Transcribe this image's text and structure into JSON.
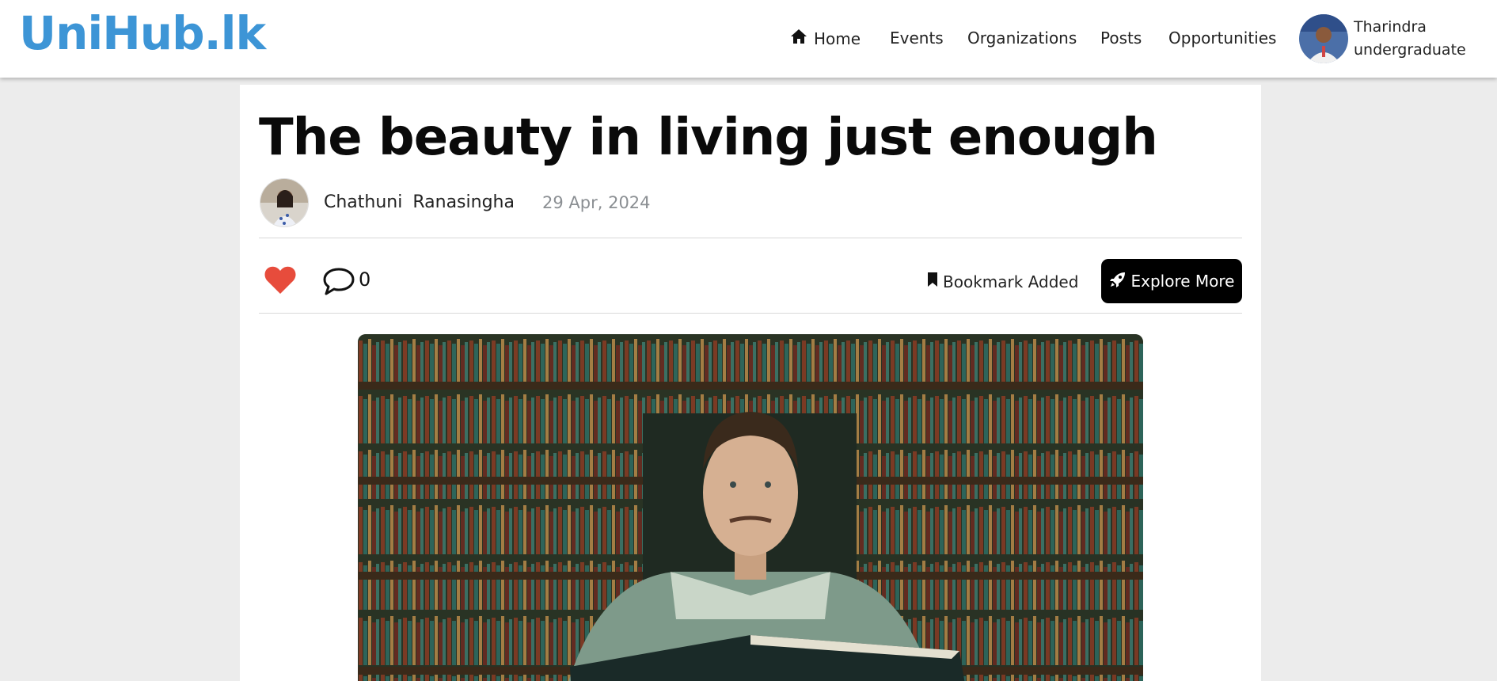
{
  "header": {
    "logo": "UniHub.lk",
    "nav": {
      "home": "Home",
      "events": "Events",
      "organizations": "Organizations",
      "posts": "Posts",
      "opportunities": "Opportunities"
    },
    "user": {
      "name": "Tharindra",
      "role": "undergraduate"
    }
  },
  "article": {
    "title": "The beauty in living just enough",
    "author": "Chathuni Ranasingha",
    "date": "29 Apr, 2024",
    "comment_count": "0",
    "bookmark_label": "Bookmark Added",
    "explore_label": "Explore More",
    "liked": true
  },
  "colors": {
    "brand": "#3d95d6",
    "like": "#e74c3c",
    "button": "#000000"
  },
  "icons": [
    "home-icon",
    "heart-icon",
    "comment-icon",
    "bookmark-icon",
    "rocket-icon"
  ]
}
